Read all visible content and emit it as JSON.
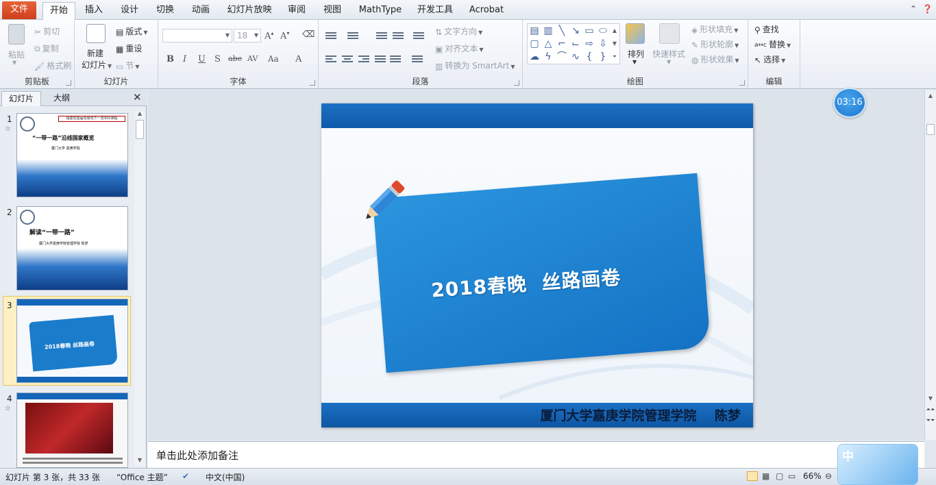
{
  "tabs": [
    {
      "label": "文件",
      "kind": "file"
    },
    {
      "label": "开始",
      "kind": "active"
    },
    {
      "label": "插入"
    },
    {
      "label": "设计"
    },
    {
      "label": "切换"
    },
    {
      "label": "动画"
    },
    {
      "label": "幻灯片放映"
    },
    {
      "label": "审阅"
    },
    {
      "label": "视图"
    },
    {
      "label": "MathType"
    },
    {
      "label": "开发工具"
    },
    {
      "label": "Acrobat"
    }
  ],
  "ribbon": {
    "clipboard": {
      "label": "剪贴板",
      "paste": "粘贴",
      "cut": "剪切",
      "copy": "复制",
      "format_painter": "格式刷"
    },
    "slides": {
      "label": "幻灯片",
      "new_slide_1": "新建",
      "new_slide_2": "幻灯片",
      "layout": "版式",
      "reset": "重设",
      "section": "节"
    },
    "font": {
      "label": "字体",
      "font_name": "",
      "font_size": "18"
    },
    "paragraph": {
      "label": "段落",
      "text_direction": "文字方向",
      "align_text": "对齐文本",
      "smartart": "转换为 SmartArt"
    },
    "drawing": {
      "label": "绘图",
      "arrange": "排列",
      "quick_styles": "快速样式",
      "shape_fill": "形状填充",
      "shape_outline": "形状轮廓",
      "shape_effects": "形状效果"
    },
    "editing": {
      "label": "编辑",
      "find": "查找",
      "replace": "替换",
      "select": "选择"
    }
  },
  "leftpane": {
    "tab_slides": "幻灯片",
    "tab_outline": "大纲",
    "slides": [
      {
        "num": "1",
        "star": "☆",
        "title": "“一带一路”沿线国家概览",
        "subtitle": "厦门大学 嘉庚学院",
        "banner": "福建省首届省级线下一流本科课程"
      },
      {
        "num": "2",
        "star": "",
        "title": "解读“一带一路”",
        "subtitle": "厦门大学嘉庚学院管理学院 陈梦"
      },
      {
        "num": "3",
        "star": "",
        "title": "2018春晚 丝路画卷"
      },
      {
        "num": "4",
        "star": "☆",
        "title": ""
      }
    ]
  },
  "slide": {
    "title": "2018春晚  丝路画卷",
    "footer": "厦门大学嘉庚学院管理学院    陈梦"
  },
  "notes": {
    "placeholder": "单击此处添加备注"
  },
  "timer": "03:16",
  "status": {
    "slide_info": "幻灯片 第 3 张，共 33 张",
    "theme": "“Office 主题”",
    "language": "中文(中国)",
    "zoom": "66%"
  },
  "ime": {
    "char": "中"
  },
  "colors": {
    "accent": "#1b74cc",
    "file_tab": "#d9481f",
    "slide_blue": "#1472c4"
  }
}
